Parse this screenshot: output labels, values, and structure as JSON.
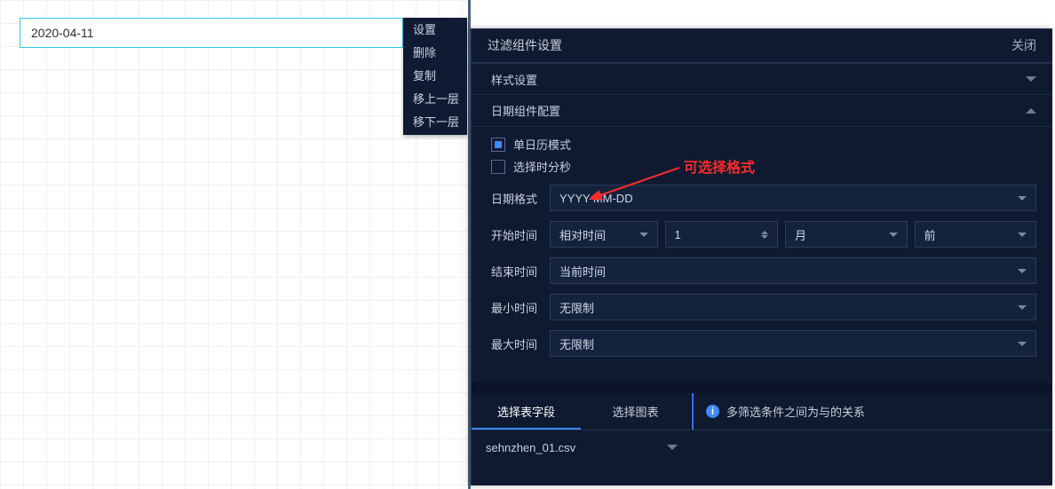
{
  "canvas": {
    "date_picker_value": "2020-04-11"
  },
  "context_menu": {
    "items": [
      "设置",
      "删除",
      "复制",
      "移上一层",
      "移下一层"
    ]
  },
  "panel": {
    "title": "过滤组件设置",
    "close_label": "关闭",
    "sections": {
      "style": {
        "title": "样式设置"
      },
      "date_config": {
        "title": "日期组件配置"
      }
    },
    "checkbox_single_calendar": {
      "label": "单日历模式",
      "checked": true
    },
    "checkbox_select_hms": {
      "label": "选择时分秒",
      "checked": false
    },
    "date_format": {
      "label": "日期格式",
      "value": "YYYY-MM-DD"
    },
    "start_time": {
      "label": "开始时间",
      "mode": "相对时间",
      "amount": "1",
      "unit": "月",
      "direction": "前"
    },
    "end_time": {
      "label": "结束时间",
      "value": "当前时间"
    },
    "min_time": {
      "label": "最小时间",
      "value": "无限制"
    },
    "max_time": {
      "label": "最大时间",
      "value": "无限制"
    }
  },
  "annotation": {
    "text": "可选择格式"
  },
  "bottom": {
    "tabs": [
      "选择表字段",
      "选择图表"
    ],
    "active_tab": 0,
    "info_text": "多筛选条件之间为与的关系",
    "file_selected": "sehnzhen_01.csv"
  }
}
